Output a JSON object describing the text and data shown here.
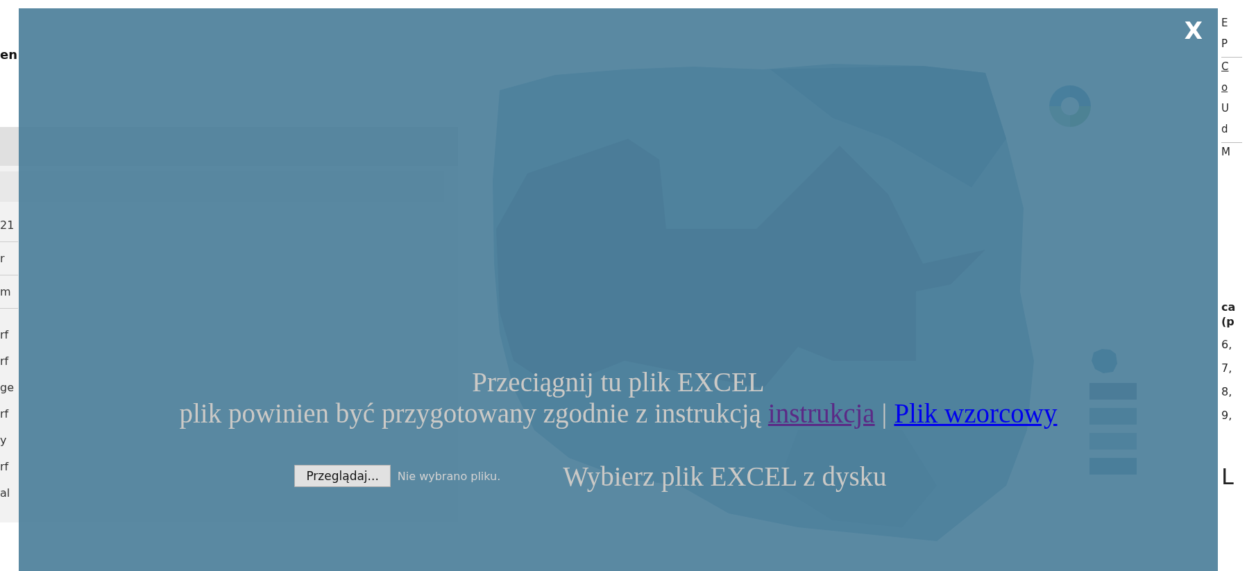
{
  "heading": "en",
  "panel": {
    "categories": [
      "21",
      "r",
      "m"
    ],
    "indicators": [
      "rf",
      "rf",
      "ge",
      "rf",
      "y",
      "rf",
      "al"
    ]
  },
  "side_column": {
    "sections": [
      {
        "items": [
          {
            "text": "E",
            "kind": "text"
          },
          {
            "text": "P",
            "kind": "text"
          }
        ]
      },
      {
        "items": [
          {
            "text": "C",
            "kind": "link"
          },
          {
            "text": "o",
            "kind": "link"
          },
          {
            "text": "U",
            "kind": "text"
          },
          {
            "text": "d",
            "kind": "text"
          }
        ]
      },
      {
        "items": [
          {
            "text": "M",
            "kind": "text"
          }
        ]
      }
    ],
    "legend_title_lines": [
      "ca",
      "(p"
    ],
    "legend_ranges": [
      "6,",
      "7,",
      "8,",
      "9,"
    ],
    "footer": "L"
  },
  "overlay": {
    "close": "X",
    "drop_title": "Przeciągnij tu plik EXCEL",
    "instruction": "plik powinien być przygotowany zgodnie z instrukcją",
    "instruction_link": "instrukcja",
    "separator": "|",
    "template_link": "Plik wzorcowy",
    "browse_button": "Przeglądaj...",
    "file_status": "Nie wybrano pliku.",
    "choose_label": "Wybierz plik EXCEL z dysku"
  }
}
